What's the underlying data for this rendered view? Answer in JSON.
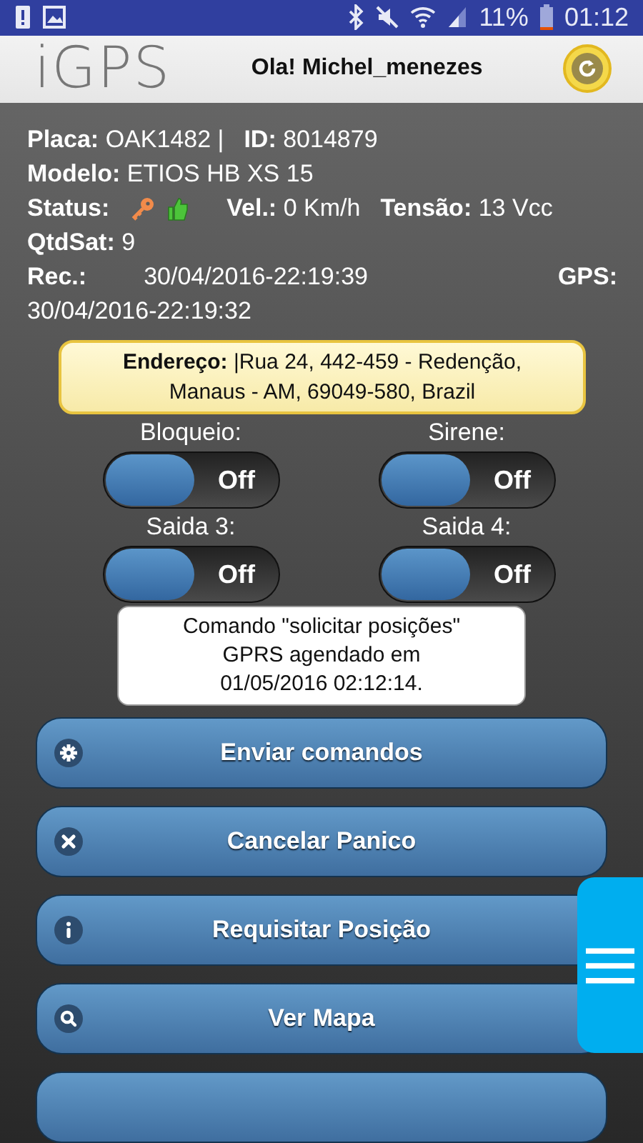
{
  "status_bar": {
    "battery": "11%",
    "time": "01:12"
  },
  "header": {
    "logo": "iGPS",
    "greeting": "Ola! Michel_menezes"
  },
  "vehicle": {
    "lines": [
      {
        "kind": "text",
        "segments": [
          {
            "label": "Placa:",
            "value": "OAK1482 |"
          },
          {
            "label": "ID:",
            "value": "8014879"
          }
        ]
      },
      {
        "kind": "text",
        "segments": [
          {
            "label": "Modelo:",
            "value": "ETIOS HB XS 15"
          }
        ]
      },
      {
        "kind": "status",
        "label": "Status:",
        "segments": [
          {
            "label": "Vel.:",
            "value": "0 Km/h"
          },
          {
            "label": "Tensão:",
            "value": "13 Vcc"
          }
        ]
      },
      {
        "kind": "text",
        "segments": [
          {
            "label": "QtdSat:",
            "value": "9"
          }
        ]
      },
      {
        "kind": "split",
        "segments": [
          {
            "label": "Rec.:",
            "value": "30/04/2016-22:19:39"
          },
          {
            "label": "GPS:"
          }
        ]
      },
      {
        "kind": "text",
        "segments": [
          {
            "value": "30/04/2016-22:19:32"
          }
        ]
      }
    ]
  },
  "address": {
    "label": "Endereço:",
    "lines": [
      "|Rua 24, 442-459 - Redenção,",
      "Manaus - AM, 69049-580, Brazil"
    ]
  },
  "switches": [
    {
      "label": "Bloqueio:",
      "on": false,
      "state_text": "Off"
    },
    {
      "label": "Sirene:",
      "on": false,
      "state_text": "Off"
    },
    {
      "label": "Saida 3:",
      "on": false,
      "state_text": "Off"
    },
    {
      "label": "Saida 4:",
      "on": false,
      "state_text": "Off"
    }
  ],
  "message": [
    "Comando \"solicitar posições\"",
    "GPRS agendado em",
    "01/05/2016 02:12:14."
  ],
  "buttons": [
    {
      "label": "Enviar comandos"
    },
    {
      "label": "Cancelar Panico"
    },
    {
      "label": "Requisitar Posição"
    },
    {
      "label": "Ver Mapa"
    }
  ]
}
